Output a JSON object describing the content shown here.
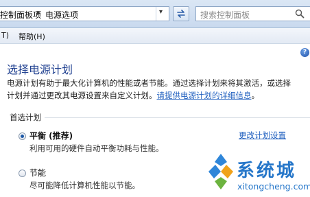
{
  "address_bar": {
    "breadcrumb": [
      "控制面板项",
      "电源选项"
    ],
    "separator": "▸",
    "dropdown": "▾",
    "search_placeholder": "搜索控制面板"
  },
  "menu": {
    "items": [
      "T)",
      "帮助(H)"
    ]
  },
  "help_icon_text": "?",
  "main": {
    "title": "选择电源计划",
    "desc_line1": "电源计划有助于最大化计算机的性能或者节能。通过选择计划来将其激活，或选择",
    "desc_line2_text": "计划并通过更改其电源设置来自定义计划。",
    "desc_link": "请提供电源计划的详细信息",
    "desc_end": "。"
  },
  "group": {
    "title": "首选计划",
    "plans": [
      {
        "name": "平衡 (推荐)",
        "desc": "利用可用的硬件自动平衡功耗与性能。",
        "selected": true,
        "change_link": "更改计划设置"
      },
      {
        "name": "节能",
        "desc": "尽可能降低计算机性能以节能。",
        "selected": false
      }
    ]
  },
  "watermark": {
    "name": "系统城",
    "domain": "xitongcheng.com"
  },
  "colors": {
    "title": "#1e3f8f",
    "link": "#1f5fbf",
    "watermark": "#2576c9"
  }
}
